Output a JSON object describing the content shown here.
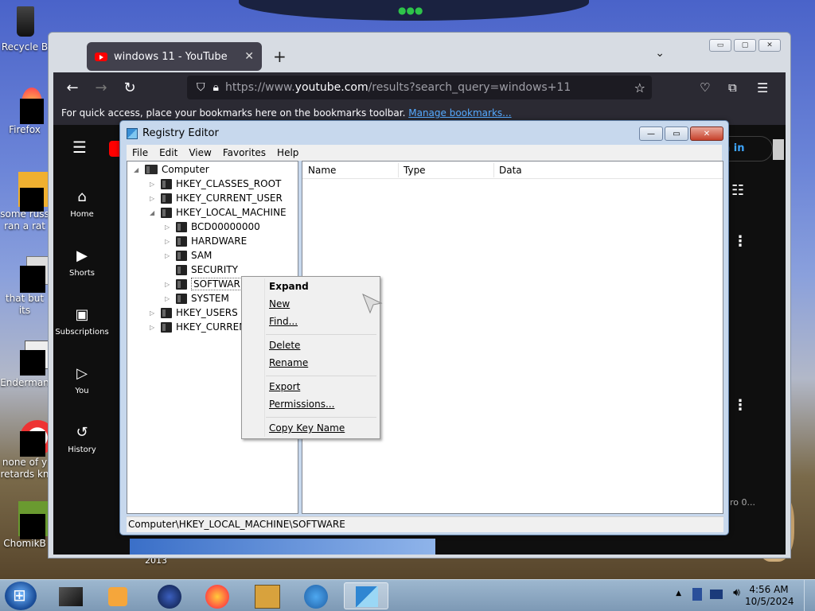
{
  "desktop": {
    "icons": [
      {
        "label": "Recycle B"
      },
      {
        "label": "Firefox"
      },
      {
        "label": "some russ",
        "label2": "ran a rat"
      },
      {
        "label": "that but its"
      },
      {
        "label": "Enderman"
      },
      {
        "label": "none of y",
        "label2": "retards kn"
      },
      {
        "label": "ChomikB"
      }
    ],
    "stray_text": "2013",
    "stray_text2": "ro 0..."
  },
  "browser": {
    "tab_title": "windows 11 - YouTube",
    "tab_close": "✕",
    "new_tab": "+",
    "tab_list": "⌄",
    "url_prefix": "https://www.",
    "url_host": "youtube.com",
    "url_suffix": "/results?search_query=windows+11",
    "bookmarks_text": "For quick access, place your bookmarks here on the bookmarks toolbar.",
    "bookmarks_link": "Manage bookmarks...",
    "win_min": "▭",
    "win_max": "▢",
    "win_close": "✕"
  },
  "youtube": {
    "sidebar": [
      {
        "label": "Home",
        "icon": "⌂"
      },
      {
        "label": "Shorts",
        "icon": "▶"
      },
      {
        "label": "Subscriptions",
        "icon": "▣"
      },
      {
        "label": "You",
        "icon": "▷"
      },
      {
        "label": "History",
        "icon": "↺"
      }
    ],
    "sign_in": "n in",
    "menu_icon": "☰"
  },
  "regedit": {
    "title": "Registry Editor",
    "menu": [
      "File",
      "Edit",
      "View",
      "Favorites",
      "Help"
    ],
    "ctrl_min": "—",
    "ctrl_max": "▭",
    "ctrl_close": "✕",
    "tree": [
      {
        "label": "Computer",
        "twisty": "◢"
      },
      {
        "label": "HKEY_CLASSES_ROOT",
        "twisty": "▷"
      },
      {
        "label": "HKEY_CURRENT_USER",
        "twisty": "▷"
      },
      {
        "label": "HKEY_LOCAL_MACHINE",
        "twisty": "◢"
      },
      {
        "label": "BCD00000000",
        "twisty": "▷"
      },
      {
        "label": "HARDWARE",
        "twisty": "▷"
      },
      {
        "label": "SAM",
        "twisty": "▷"
      },
      {
        "label": "SECURITY",
        "twisty": ""
      },
      {
        "label": "SOFTWARE",
        "twisty": "▷"
      },
      {
        "label": "SYSTEM",
        "twisty": "▷"
      },
      {
        "label": "HKEY_USERS",
        "twisty": "▷"
      },
      {
        "label": "HKEY_CURRENT",
        "twisty": "▷"
      }
    ],
    "columns": [
      "Name",
      "Type",
      "Data"
    ],
    "status": "Computer\\HKEY_LOCAL_MACHINE\\SOFTWARE"
  },
  "context_menu": {
    "items": [
      "Expand",
      "New",
      "Find...",
      "Delete",
      "Rename",
      "Export",
      "Permissions...",
      "Copy Key Name"
    ]
  },
  "taskbar": {
    "time": "4:56 AM",
    "date": "10/5/2024"
  }
}
